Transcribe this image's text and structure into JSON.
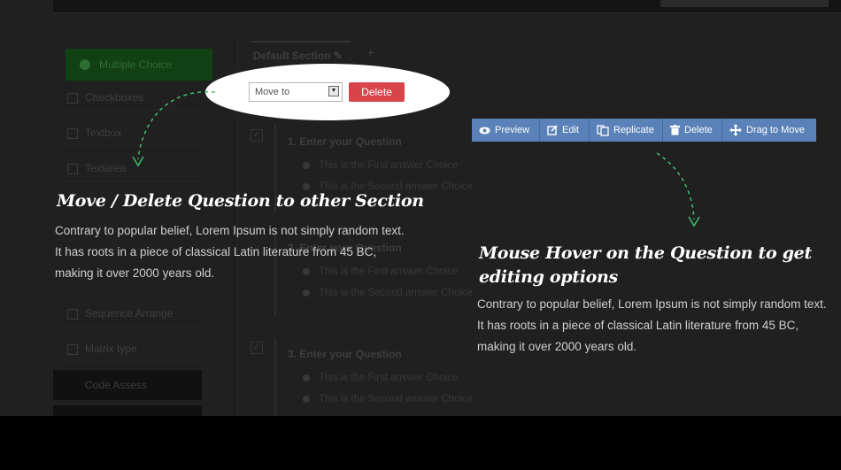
{
  "background": {
    "section_tab": "Default Section",
    "add_section": "+",
    "sidebar": {
      "multiple_choice": "Multiple Choice",
      "items": [
        "Checkboxes",
        "Textbox",
        "Textarea"
      ],
      "lower_items": [
        "Sequence Arrange",
        "Matrix type"
      ],
      "code_assess": "Code Assess"
    },
    "questions": [
      {
        "title": "1. Enter your Question",
        "answers": [
          "This is the First answer Choice",
          "This is the Second answer Choice"
        ]
      },
      {
        "title": "2. Enter your Question",
        "answers": [
          "This is the First answer Choice",
          "This is the Second answer Choice"
        ]
      },
      {
        "title": "3. Enter your Question",
        "answers": [
          "This is the First answer Choice",
          "This is the Second answer Choice"
        ]
      }
    ]
  },
  "move_controls": {
    "select_value": "Move to",
    "delete_label": "Delete"
  },
  "toolbar": [
    {
      "label": "Preview",
      "icon": "eye-icon"
    },
    {
      "label": "Edit",
      "icon": "edit-icon"
    },
    {
      "label": "Replicate",
      "icon": "replicate-icon"
    },
    {
      "label": "Delete",
      "icon": "trash-icon"
    },
    {
      "label": "Drag to Move",
      "icon": "move-arrows-icon"
    }
  ],
  "annotations": {
    "left": {
      "title": "Move / Delete Question to other Section",
      "body": "Contrary to popular belief, Lorem Ipsum is not simply random text. It has roots in a piece of classical Latin literature from 45 BC, making it over 2000 years old."
    },
    "right": {
      "title_line1": "Mouse Hover on the Question to get",
      "title_line2": "editing options",
      "body": "Contrary to popular belief, Lorem Ipsum is not simply random text. It has roots in a piece of classical Latin literature from 45 BC, making it over 2000 years old."
    }
  },
  "colors": {
    "overlay": "#202020",
    "delete_red": "#d9434a",
    "toolbar_blue": "#5b81b9",
    "arrow_green": "#3fbf6f"
  }
}
